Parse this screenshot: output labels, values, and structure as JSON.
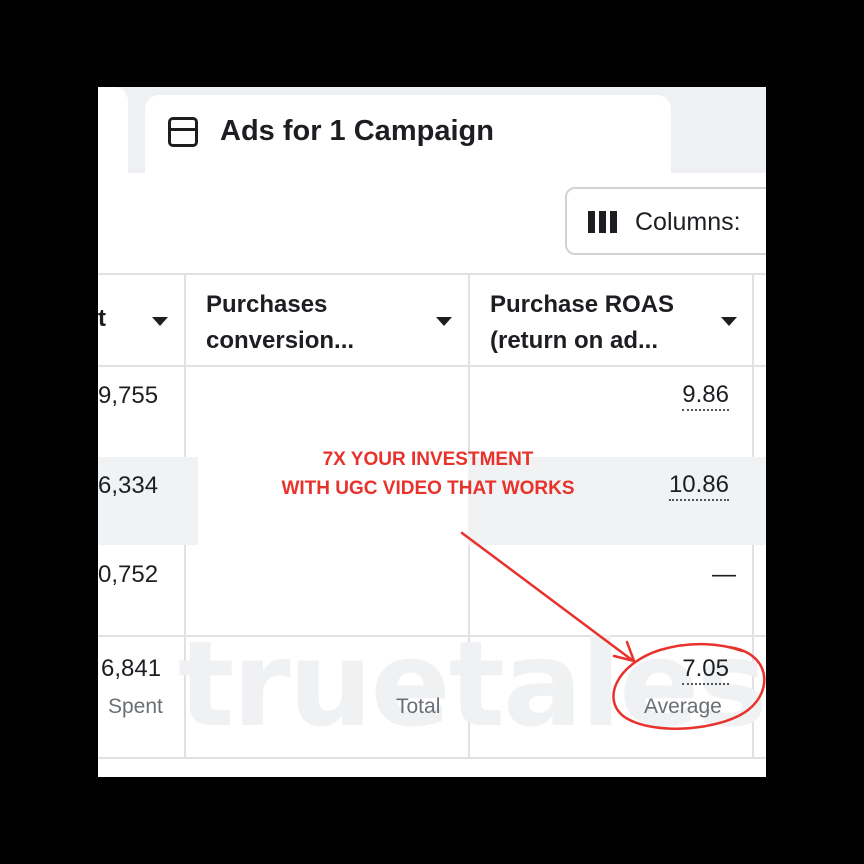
{
  "tab": {
    "title": "Ads for 1 Campaign",
    "icon": "window-icon"
  },
  "toolbar": {
    "columns_label": "Columns:",
    "columns_icon": "columns-icon"
  },
  "table": {
    "headers": [
      {
        "line1": "t",
        "line2": ""
      },
      {
        "line1": "Purchases",
        "line2": "conversion..."
      },
      {
        "line1": "Purchase ROAS",
        "line2": "(return on ad..."
      }
    ],
    "rows": [
      {
        "spent": "9,755",
        "purchases": "",
        "roas": "9.86"
      },
      {
        "spent": "6,334",
        "purchases": "",
        "roas": "10.86"
      },
      {
        "spent": "0,752",
        "purchases": "",
        "roas": "—"
      }
    ],
    "summary": {
      "spent_value": "6,841",
      "spent_label": "Spent",
      "purchases_label": "Total",
      "roas_value": "7.05",
      "roas_label": "Average"
    }
  },
  "promo": {
    "line1": "7X YOUR INVESTMENT",
    "line2": "WITH UGC VIDEO THAT WORKS",
    "color": "#e8322c"
  },
  "watermark": "truetales"
}
